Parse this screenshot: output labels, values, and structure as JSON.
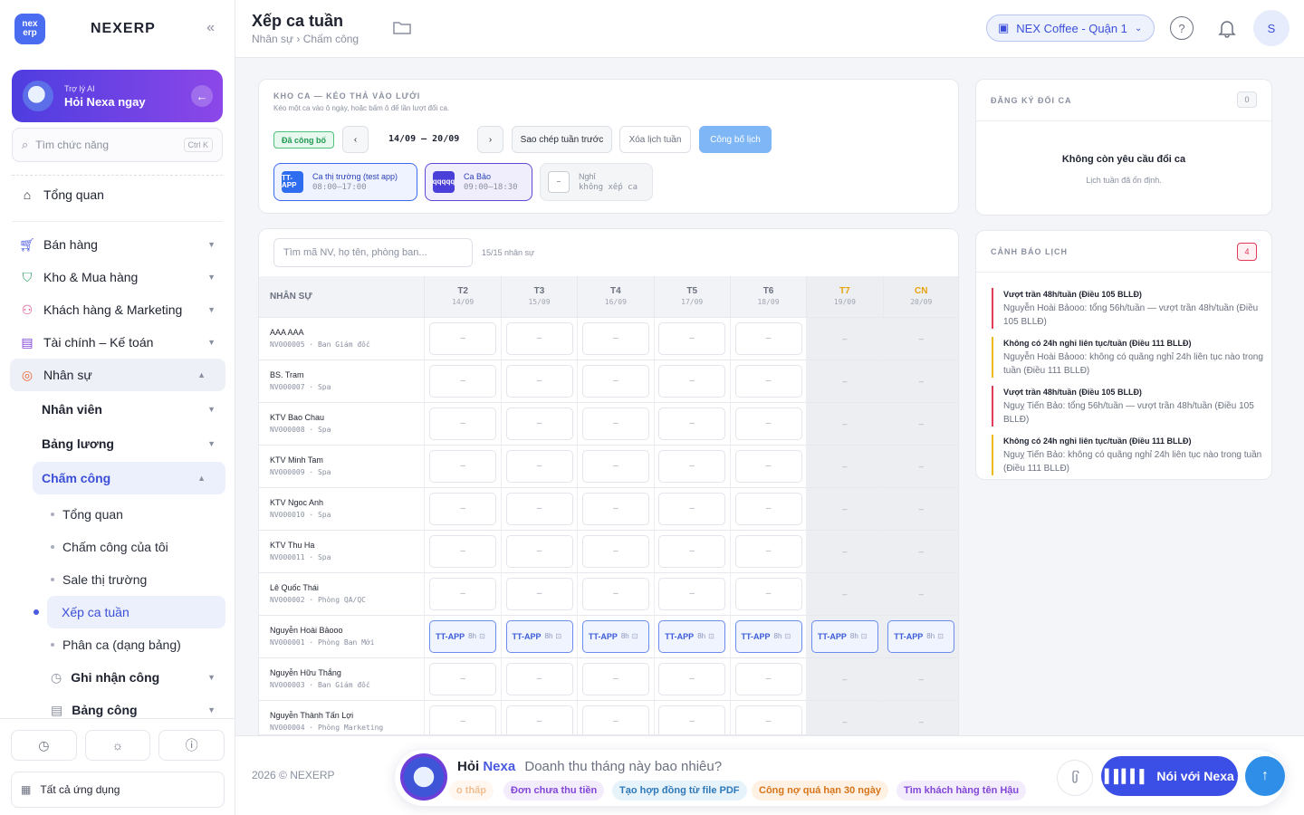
{
  "app": {
    "brand": "NEXERP",
    "logo_text": "nex erp"
  },
  "sidebar": {
    "ai": {
      "subtitle": "Trợ lý AI",
      "title": "Hỏi Nexa ngay"
    },
    "search": {
      "placeholder": "Tìm chức năng",
      "shortcut": "Ctrl K"
    },
    "overview": "Tổng quan",
    "modules": [
      {
        "label": "Bán hàng",
        "icon": "cart-icon"
      },
      {
        "label": "Kho & Mua hàng",
        "icon": "bag-icon"
      },
      {
        "label": "Khách hàng & Marketing",
        "icon": "people-icon"
      },
      {
        "label": "Tài chính – Kế toán",
        "icon": "calculator-icon"
      },
      {
        "label": "Nhân sự",
        "icon": "person-icon"
      }
    ],
    "hr_sub": [
      "Nhân viên",
      "Bảng lương",
      "Chấm công"
    ],
    "attendance_items": [
      "Tổng quan",
      "Chấm công của tôi",
      "Sale thị trường",
      "Xếp ca tuần",
      "Phân ca (dạng bảng)"
    ],
    "attendance_groups": [
      "Ghi nhận công",
      "Bảng công"
    ],
    "all_apps": "Tất cả ứng dụng"
  },
  "header": {
    "title": "Xếp ca tuần",
    "breadcrumb": "Nhân sự › Chấm công",
    "store": "NEX Coffee - Quận 1",
    "avatar": "S"
  },
  "shift_bank": {
    "caption": "KHO CA — KÉO THẢ VÀO LƯỚI",
    "hint": "Kéo một ca vào ô ngày, hoặc bấm ô để lần lượt đổi ca.",
    "status": "Đã công bố",
    "week": "14/09 – 20/09",
    "prev": "‹",
    "next": "›",
    "copy_btn": "Sao chép tuần trước",
    "clear_btn": "Xóa lịch tuần",
    "publish_btn": "Công bố lịch",
    "shifts": [
      {
        "badge": "TT-APP",
        "name": "Ca thị trường (test app)",
        "time": "08:00–17:00",
        "color": "#2f6df0"
      },
      {
        "badge": "qqqqq",
        "name": "Ca Bảo",
        "time": "09:00–18:30",
        "color": "#4a3fd8"
      },
      {
        "badge": "–",
        "name": "Nghỉ",
        "time": "không xếp ca",
        "color": "#ffffff"
      }
    ]
  },
  "schedule": {
    "search_placeholder": "Tìm mã NV, họ tên, phòng ban...",
    "count": "15/15 nhân sự",
    "col_header": "NHÂN SỰ",
    "days": [
      {
        "d": "T2",
        "date": "14/09",
        "weekend": false
      },
      {
        "d": "T3",
        "date": "15/09",
        "weekend": false
      },
      {
        "d": "T4",
        "date": "16/09",
        "weekend": false
      },
      {
        "d": "T5",
        "date": "17/09",
        "weekend": false
      },
      {
        "d": "T6",
        "date": "18/09",
        "weekend": false
      },
      {
        "d": "T7",
        "date": "19/09",
        "weekend": true
      },
      {
        "d": "CN",
        "date": "20/09",
        "weekend": true
      }
    ],
    "empty": "–",
    "shift_code": "TT-APP",
    "shift_hours": "8h",
    "rows": [
      {
        "name": "AAA AAA",
        "code": "NV000005 · Ban Giám đốc",
        "shifts": [
          false,
          false,
          false,
          false,
          false,
          false,
          false
        ]
      },
      {
        "name": "BS. Tram",
        "code": "NV000007 · Spa",
        "shifts": [
          false,
          false,
          false,
          false,
          false,
          false,
          false
        ]
      },
      {
        "name": "KTV Bao Chau",
        "code": "NV000008 · Spa",
        "shifts": [
          false,
          false,
          false,
          false,
          false,
          false,
          false
        ]
      },
      {
        "name": "KTV Minh Tam",
        "code": "NV000009 · Spa",
        "shifts": [
          false,
          false,
          false,
          false,
          false,
          false,
          false
        ]
      },
      {
        "name": "KTV Ngoc Anh",
        "code": "NV000010 · Spa",
        "shifts": [
          false,
          false,
          false,
          false,
          false,
          false,
          false
        ]
      },
      {
        "name": "KTV Thu Ha",
        "code": "NV000011 · Spa",
        "shifts": [
          false,
          false,
          false,
          false,
          false,
          false,
          false
        ]
      },
      {
        "name": "Lê Quốc Thái",
        "code": "NV000002 · Phòng QA/QC",
        "shifts": [
          false,
          false,
          false,
          false,
          false,
          false,
          false
        ]
      },
      {
        "name": "Nguyễn Hoài Bảooo",
        "code": "NV000001 · Phòng Ban Mới",
        "shifts": [
          true,
          true,
          true,
          true,
          true,
          true,
          true
        ]
      },
      {
        "name": "Nguyễn Hữu Thắng",
        "code": "NV000003 · Ban Giám đốc",
        "shifts": [
          false,
          false,
          false,
          false,
          false,
          false,
          false
        ]
      },
      {
        "name": "Nguyễn Thành Tấn Lợi",
        "code": "NV000004 · Phòng Marketing",
        "shifts": [
          false,
          false,
          false,
          false,
          false,
          false,
          false
        ]
      }
    ]
  },
  "swap": {
    "caption": "ĐĂNG KÝ ĐỔI CA",
    "count": "0",
    "empty_title": "Không còn yêu cầu đổi ca",
    "empty_sub": "Lịch tuần đã ổn định."
  },
  "alerts": {
    "caption": "CẢNH BÁO LỊCH",
    "count": "4",
    "items": [
      {
        "level": "red",
        "title": "Vượt trần 48h/tuần (Điều 105 BLLĐ)",
        "body": "Nguyễn Hoài Bảooo: tổng 56h/tuần — vượt trần 48h/tuần (Điều 105 BLLĐ)"
      },
      {
        "level": "yel",
        "title": "Không có 24h nghỉ liên tục/tuần (Điều 111 BLLĐ)",
        "body": "Nguyễn Hoài Bảooo: không có quãng nghỉ 24h liên tục nào trong tuần (Điều 111 BLLĐ)"
      },
      {
        "level": "red",
        "title": "Vượt trần 48h/tuần (Điều 105 BLLĐ)",
        "body": "Nguỵ Tiến Bảo: tổng 56h/tuần — vượt trần 48h/tuần (Điều 105 BLLĐ)"
      },
      {
        "level": "yel",
        "title": "Không có 24h nghỉ liên tục/tuần (Điều 111 BLLĐ)",
        "body": "Nguỵ Tiến Bảo: không có quãng nghỉ 24h liên tục nào trong tuần (Điều 111 BLLĐ)"
      }
    ]
  },
  "footer": {
    "copyright": "2026 © NEXERP",
    "ask_prefix": "Hỏi",
    "ask_brand": "Nexa",
    "ask_placeholder": "Doanh thu tháng này bao nhiêu?",
    "suggestions": [
      {
        "label": "o thấp",
        "bg": "#fff1e4",
        "fg": "#e68a3a"
      },
      {
        "label": "Đơn chưa thu tiền",
        "bg": "#f3ecfc",
        "fg": "#8246d8"
      },
      {
        "label": "Tạo hợp đồng từ file PDF",
        "bg": "#e6f3fb",
        "fg": "#2f78b8"
      },
      {
        "label": "Công nợ quá hạn 30 ngày",
        "bg": "#fff1e4",
        "fg": "#d8741a"
      },
      {
        "label": "Tìm khách hàng tên Hậu",
        "bg": "#f3ecfc",
        "fg": "#8246d8"
      }
    ],
    "talk": "Nói với Nexa"
  }
}
